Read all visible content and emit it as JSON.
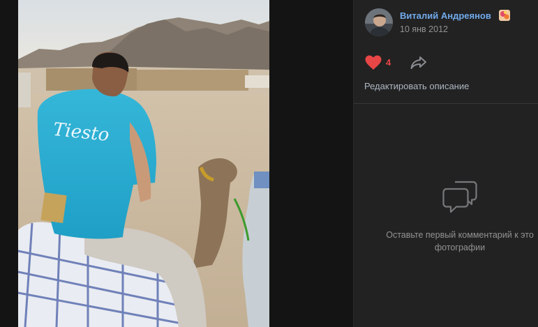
{
  "author": {
    "name": "Виталий Андреянов",
    "date": "10 янв 2012"
  },
  "likes": {
    "count": "4"
  },
  "edit_description": "Редактировать описание",
  "comments": {
    "empty_text": "Оставьте первый комментарий к это фотографии"
  },
  "colors": {
    "accent_link": "#71aaeb",
    "like_red": "#e64646",
    "panel_bg": "#222222",
    "viewer_bg": "#141414"
  },
  "icons": [
    "heart-icon",
    "share-icon",
    "comment-icon",
    "status-badge-icon"
  ]
}
